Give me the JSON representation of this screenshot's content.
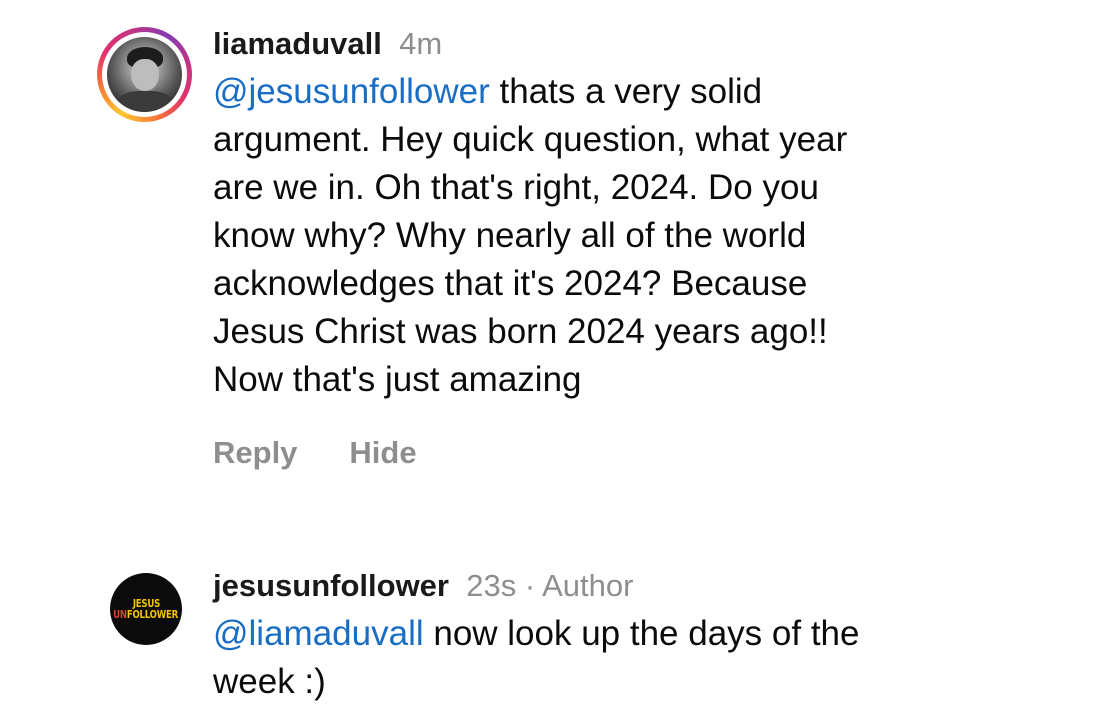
{
  "comments": [
    {
      "username": "liamaduvall",
      "time": "4m",
      "mention": "@jesusunfollower",
      "text_lines": [
        " thats a very solid",
        "argument. Hey quick question, what year",
        "are we in. Oh that's right, 2024. Do you",
        "know why? Why nearly all of the world",
        "acknowledges that it's 2024? Because",
        "Jesus Christ was born 2024 years ago!!",
        "Now that's just amazing"
      ],
      "actions": {
        "reply": "Reply",
        "hide": "Hide"
      }
    },
    {
      "username": "jesusunfollower",
      "time": "23s",
      "separator": " · ",
      "author_badge": "Author",
      "avatar_logo": {
        "line1": "JESUS",
        "line2_red": "UN",
        "line2_yellow": "FOLLOWER"
      },
      "mention": "@liamaduvall",
      "text_lines": [
        " now look up the days of the",
        "week :)"
      ]
    }
  ],
  "colors": {
    "mention": "#1a6dc4",
    "meta": "#8e8e8e",
    "text": "#0b0b0b"
  }
}
